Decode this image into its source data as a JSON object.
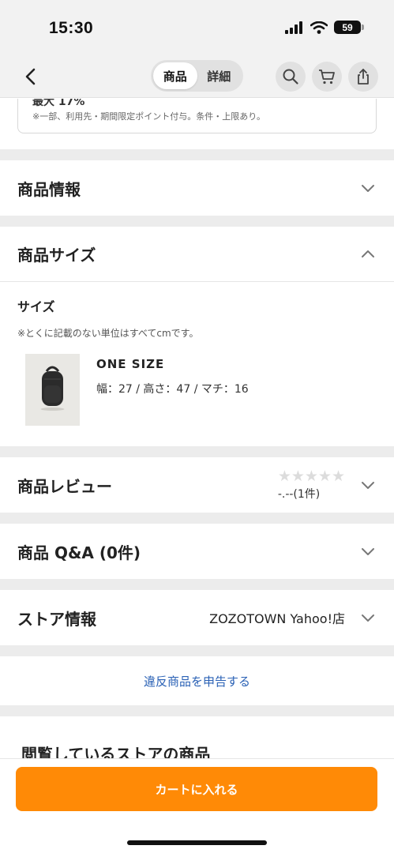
{
  "status": {
    "time": "15:30",
    "battery": "59"
  },
  "nav": {
    "tabs": [
      {
        "label": "商品"
      },
      {
        "label": "詳細"
      }
    ]
  },
  "point": {
    "top_text": "最大 17%",
    "note": "※一部、利用先・期間限定ポイント付与。条件・上限あり。"
  },
  "sections": {
    "product_info": "商品情報",
    "product_size": "商品サイズ",
    "review": "商品レビュー",
    "qa": "商品 Q&A (0件)",
    "store": "ストア情報"
  },
  "size": {
    "label": "サイズ",
    "note": "※とくに記載のない単位はすべてcmです。",
    "name": "ONE SIZE",
    "dims": "幅：27 / 高さ：47 / マチ：16"
  },
  "review": {
    "stars": "★★★★★",
    "count": "-.--(1件)"
  },
  "store": {
    "name": "ZOZOTOWN Yahoo!店"
  },
  "report": {
    "label": "違反商品を申告する"
  },
  "browsing": {
    "title": "閲覧しているストアの商品"
  },
  "cart": {
    "label": "カートに入れる"
  },
  "colors": {
    "accent": "#ff8a06",
    "link": "#2a61b5"
  }
}
